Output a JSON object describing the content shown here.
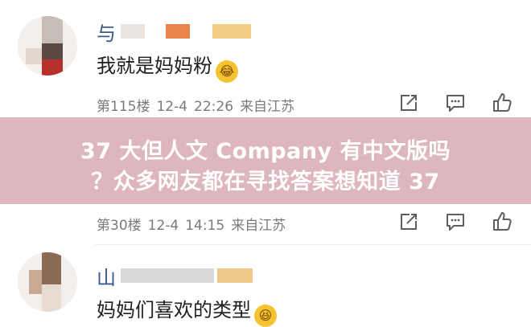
{
  "comments": [
    {
      "username": "与",
      "text": "我就是妈妈粉",
      "emoji": "😂",
      "floor": "第115楼",
      "date": "12-4",
      "time": "22:26",
      "location": "来自江苏"
    },
    {
      "floor": "第30楼",
      "date": "12-4",
      "time": "14:15",
      "location": "来自江苏"
    },
    {
      "username": "山",
      "text": "妈妈们喜欢的类型",
      "emoji": "😆"
    }
  ],
  "banner": {
    "line1": "37 大但人文 Company 有中文版吗",
    "line2": "？众多网友都在寻找答案想知道 37"
  },
  "icons": {
    "share": "share-icon",
    "comment": "comment-icon",
    "like": "like-icon"
  }
}
